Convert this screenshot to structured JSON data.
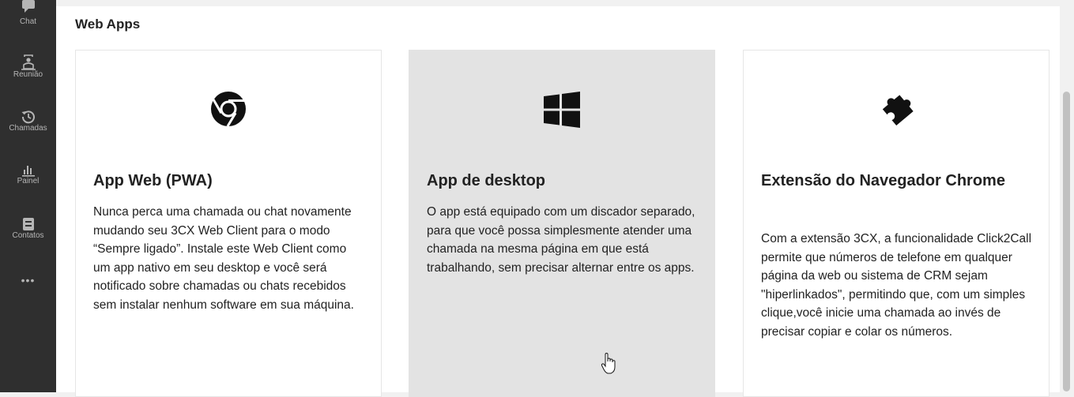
{
  "sidebar": {
    "items": [
      {
        "label": "Chat",
        "icon": "chat-icon"
      },
      {
        "label": "Reunião",
        "icon": "meeting-icon"
      },
      {
        "label": "Chamadas",
        "icon": "history-icon"
      },
      {
        "label": "Painel",
        "icon": "chart-icon"
      },
      {
        "label": "Contatos",
        "icon": "contacts-icon"
      },
      {
        "label": "•••",
        "icon": "more-icon"
      }
    ]
  },
  "main": {
    "title": "Web Apps",
    "cards": [
      {
        "icon": "chrome-icon",
        "title": "App Web (PWA)",
        "description": "Nunca perca uma chamada ou chat novamente mudando seu 3CX Web Client para o modo “Sempre ligado”. Instale este Web Client como um app nativo em seu desktop e você será notificado sobre chamadas ou chats recebidos sem instalar nenhum software em sua máquina."
      },
      {
        "icon": "windows-icon",
        "title": "App de desktop",
        "description": "O app está equipado com um discador separado, para que você possa simplesmente atender uma chamada na mesma página em que está trabalhando, sem precisar alternar entre os apps.",
        "hovered": true
      },
      {
        "icon": "puzzle-icon",
        "title": "Extensão do Navegador Chrome",
        "description": "Com a extensão 3CX, a funcionalidade Click2Call permite que números de telefone em qualquer página da web ou sistema de CRM sejam \"hiperlinkados\", permitindo que, com um simples clique,você inicie uma chamada ao invés de precisar copiar e colar os números."
      }
    ]
  },
  "colors": {
    "sidebar_bg": "#2f2f2f",
    "sidebar_text": "#b5b5b5",
    "card_hover_bg": "#e3e3e3"
  }
}
